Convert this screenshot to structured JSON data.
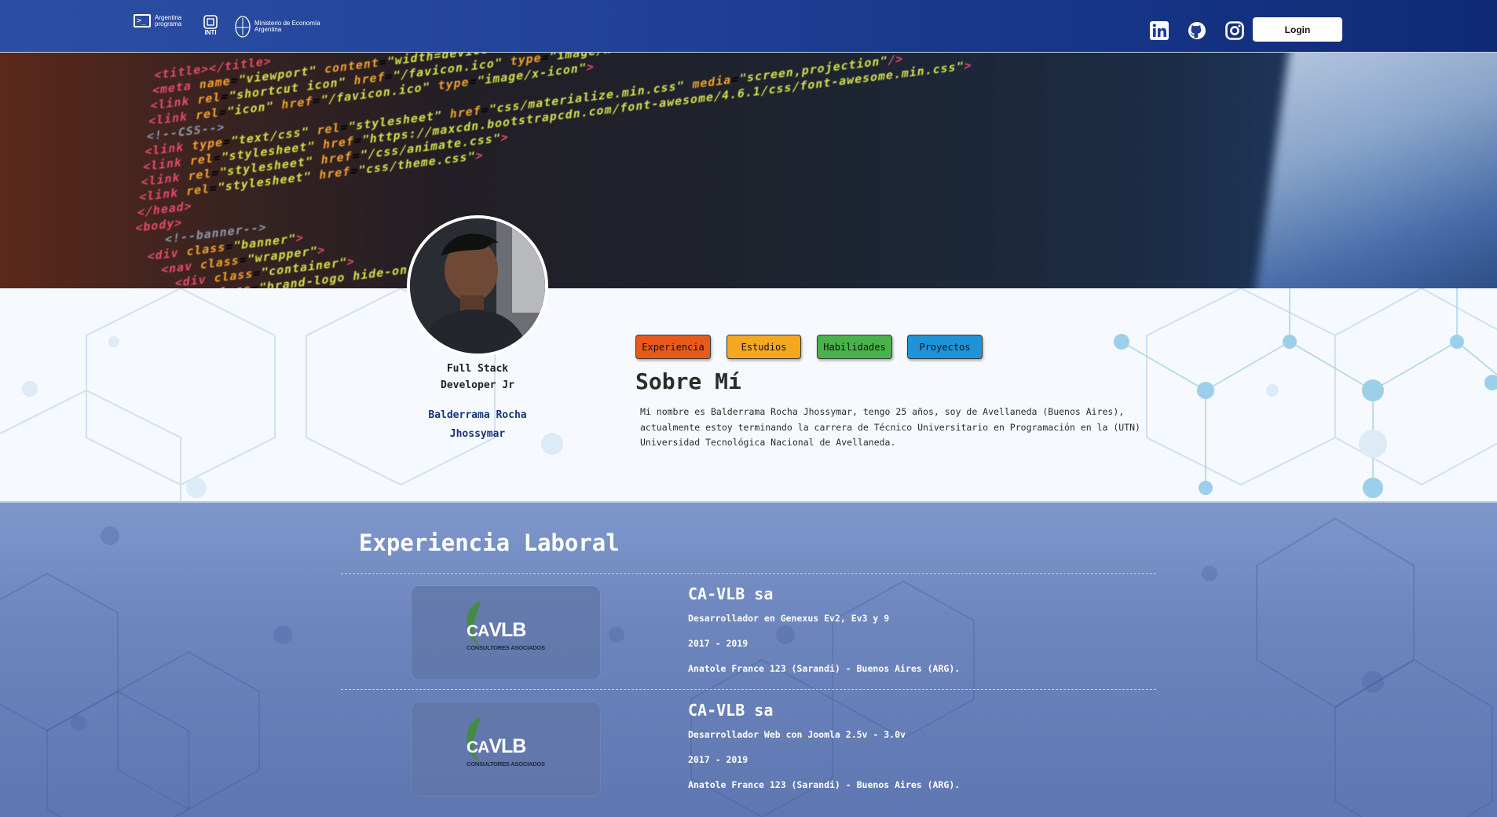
{
  "navbar": {
    "brand_argentina": [
      "Argentina",
      "programa"
    ],
    "brand_argentina_icon": ">_",
    "brand_inti": "INTI",
    "brand_ministerio": [
      "Ministerio de Economía",
      "Argentina"
    ],
    "social": [
      "linkedin-icon",
      "github-icon",
      "instagram-icon"
    ],
    "login_label": "Login"
  },
  "profile": {
    "role": "Full Stack Developer Jr",
    "name": "Balderrama Rocha Jhossymar"
  },
  "tabs": [
    {
      "label": "Experiencia",
      "color": "#e85a1b"
    },
    {
      "label": "Estudios",
      "color": "#f4a81f"
    },
    {
      "label": "Habilidades",
      "color": "#49b34a"
    },
    {
      "label": "Proyectos",
      "color": "#1f93d8"
    }
  ],
  "about": {
    "title": "Sobre Mí",
    "text": "Mi nombre es Balderrama Rocha Jhossymar, tengo 25 años, soy de Avellaneda (Buenos Aires), actualmente estoy terminando la carrera de Técnico Universitario en Programación en la (UTN) Universidad Tecnológica Nacional de Avellaneda."
  },
  "experience": {
    "title": "Experiencia Laboral",
    "jobs": [
      {
        "logo_ca": "CA",
        "logo_vlb": "VLB",
        "logo_sub": "CONSULTORES ASOCIADOS",
        "company": "CA-VLB sa",
        "position": "Desarrollador en Genexus Ev2, Ev3 y 9",
        "period": "2017 - 2019",
        "address": "Anatole France 123 (Sarandi) - Buenos Aires (ARG)."
      },
      {
        "logo_ca": "CA",
        "logo_vlb": "VLB",
        "logo_sub": "CONSULTORES ASOCIADOS",
        "company": "CA-VLB sa",
        "position": "Desarrollador Web con Joomla 2.5v - 3.0v",
        "period": "2017 - 2019",
        "address": "Anatole France 123 (Sarandi) - Buenos Aires (ARG)."
      }
    ]
  }
}
